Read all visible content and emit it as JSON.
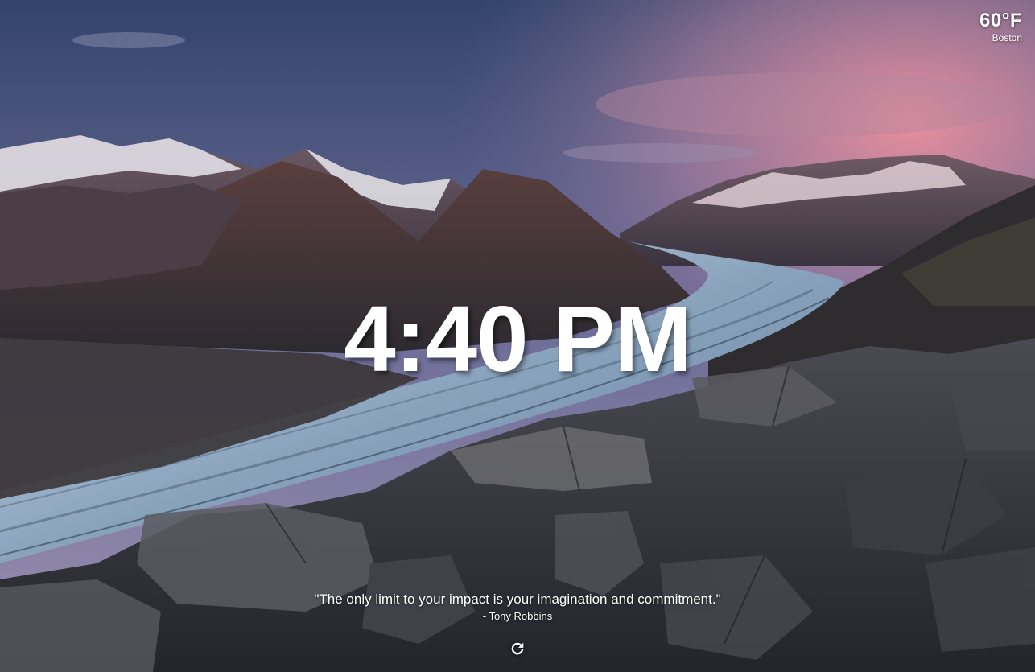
{
  "weather": {
    "temperature": "60°F",
    "location": "Boston",
    "icon": "weather-temperature"
  },
  "clock": {
    "time": "4:40 PM"
  },
  "quote": {
    "text": "\"The only limit to your impact is your imagination and commitment.\"",
    "author": "- Tony Robbins"
  },
  "controls": {
    "refresh_icon": "refresh-icon"
  },
  "background": {
    "description_color_sky_top": "#3b4a70",
    "description_color_sky_glow": "#e48a9a",
    "glacier_color": "#9db4cc",
    "rock_color": "#3a3c44"
  }
}
